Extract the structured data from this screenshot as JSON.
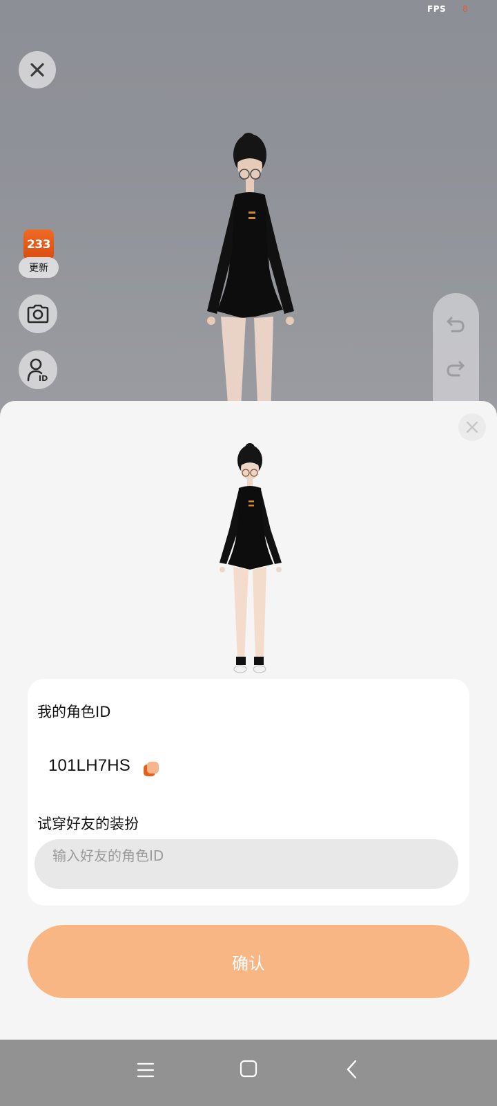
{
  "status": {
    "fps_label": "FPS",
    "fps_value": "8"
  },
  "scene": {
    "close_icon": "close-icon",
    "app_badge": "233",
    "update_label": "更新",
    "camera_icon": "camera-icon",
    "role_id_icon": "person-id-icon",
    "undo_icon": "undo-icon",
    "redo_icon": "redo-icon"
  },
  "sheet": {
    "close_icon": "close-icon",
    "my_role_id_label": "我的角色ID",
    "my_role_id": "101LH7HS",
    "copy_icon": "copy-icon",
    "try_on_label": "试穿好友的装扮",
    "friend_input_placeholder": "输入好友的角色ID",
    "friend_input_value": "",
    "confirm_label": "确认"
  },
  "navbar": {
    "menu_icon": "menu-icon",
    "home_icon": "home-icon",
    "back_icon": "back-icon"
  },
  "colors": {
    "accent": "#f8b685",
    "badge": "#e5561a",
    "sheet_bg": "#f5f5f5"
  }
}
